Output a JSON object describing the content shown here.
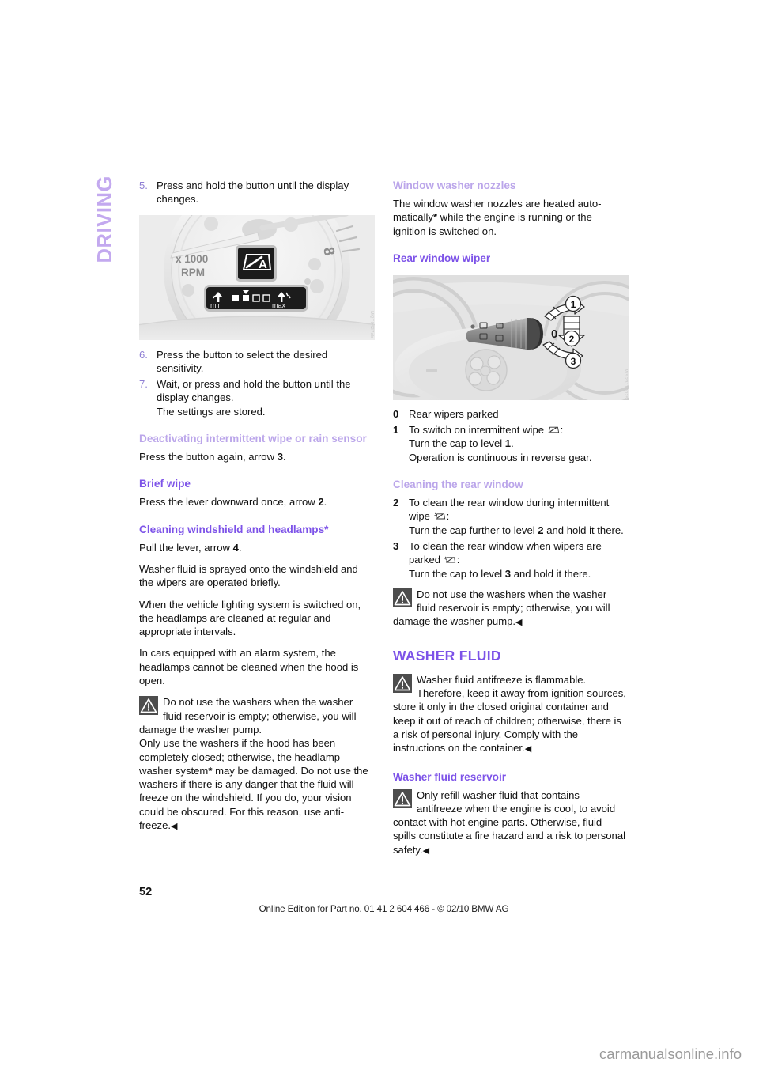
{
  "chapter": {
    "label": "DRIVING"
  },
  "left_column": {
    "step5": {
      "num": "5.",
      "text": "Press and hold the button until the display changes."
    },
    "figure1": {
      "name": "tachometer-rain-sensor-display",
      "labels": {
        "scale": "x 1000",
        "unit": "RPM",
        "min": "min",
        "max": "max",
        "auto": "A",
        "eight": "8"
      },
      "watermark": "MQT0427ab"
    },
    "step6": {
      "num": "6.",
      "text": "Press the button to select the desired sensitivity."
    },
    "step7": {
      "num": "7.",
      "text": "Wait, or press and hold the button until the display changes.",
      "text2": "The settings are stored."
    },
    "heading_deactivating": "Deactivating intermittent wipe or rain sensor",
    "deactivating_text_a": "Press the button again, arrow ",
    "deactivating_arrow": "3",
    "deactivating_text_b": ".",
    "heading_brief_wipe": "Brief wipe",
    "brief_wipe_a": "Press the lever downward once, arrow ",
    "brief_wipe_arrow": "2",
    "brief_wipe_b": ".",
    "heading_cleaning": "Cleaning windshield and headlamps*",
    "cleaning_a": "Pull the lever, arrow ",
    "cleaning_arrow": "4",
    "cleaning_b": ".",
    "cleaning_p2": "Washer fluid is sprayed onto the windshield and the wipers are operated briefly.",
    "cleaning_p3": "When the vehicle lighting system is switched on, the headlamps are cleaned at regular and appropriate intervals.",
    "cleaning_p4": "In cars equipped with an alarm system, the headlamps cannot be cleaned when the hood is open.",
    "warning1_a": "Do not use the washers when the washer fluid reservoir is empty; otherwise, you will damage the washer pump.",
    "warning1_b_pre": "Only use the washers if the hood has been completely closed; otherwise, the headlamp washer system",
    "warning1_star": "*",
    "warning1_b_post": " may be damaged. Do not use the washers if there is any danger that the fluid will freeze on the windshield. If you do, your vision could be obscured. For this reason, use anti-freeze.",
    "warning1_end": "◀"
  },
  "right_column": {
    "heading_nozzles": "Window washer nozzles",
    "nozzles_a": "The window washer nozzles are heated auto-matically",
    "nozzles_star": "*",
    "nozzles_b": " while the engine is running or the ignition is switched on.",
    "heading_rear_wiper": "Rear window wiper",
    "figure2": {
      "name": "steering-column-stalk-rear-wiper",
      "callouts": [
        "1",
        "2",
        "3"
      ],
      "zero_label": "0",
      "watermark": "WS23110025"
    },
    "item0": {
      "num": "0",
      "text": "Rear wipers parked"
    },
    "item1": {
      "num": "1",
      "line1_a": "To switch on intermittent wipe ",
      "line1_icon": "rear-wiper-icon",
      "line1_b": ":",
      "line2_a": "Turn the cap to level ",
      "line2_num": "1",
      "line2_b": ".",
      "line3": "Operation is continuous in reverse gear."
    },
    "heading_cleaning_rear": "Cleaning the rear window",
    "item2": {
      "num": "2",
      "line1_a": "To clean the rear window during intermittent wipe ",
      "line1_icon": "rear-washer-icon",
      "line1_b": ":",
      "line2_a": "Turn the cap further to level ",
      "line2_num": "2",
      "line2_b": " and hold it there."
    },
    "item3": {
      "num": "3",
      "line1_a": "To clean the rear window when wipers are parked ",
      "line1_icon": "rear-washer-icon",
      "line1_b": ":",
      "line2_a": "Turn the cap to level ",
      "line2_num": "3",
      "line2_b": " and hold it there."
    },
    "warning2": "Do not use the washers when the washer fluid reservoir is empty; otherwise, you will damage the washer pump.",
    "warning2_end": "◀",
    "heading_washer_fluid": "WASHER FLUID",
    "warning3": "Washer fluid antifreeze is flammable. Therefore, keep it away from ignition sources, store it only in the closed original container and keep it out of reach of children; otherwise, there is a risk of personal injury. Comply with the instructions on the container.",
    "warning3_end": "◀",
    "heading_reservoir": "Washer fluid reservoir",
    "warning4": "Only refill washer fluid that contains antifreeze when the engine is cool, to avoid contact with hot engine parts. Otherwise, fluid spills constitute a fire hazard and a risk to personal safety.",
    "warning4_end": "◀"
  },
  "footer": {
    "page_number": "52",
    "notice": "Online Edition for Part no. 01 41 2 604 466 - © 02/10  BMW AG",
    "site_watermark": "carmanualsonline.info"
  },
  "colors": {
    "heading_strong": "#7d53e8",
    "heading_light": "#bba6ea",
    "chapter_tab": "#c3a9ef",
    "step_number": "#8f7fd4",
    "warning_box": "#4d4d4d"
  }
}
